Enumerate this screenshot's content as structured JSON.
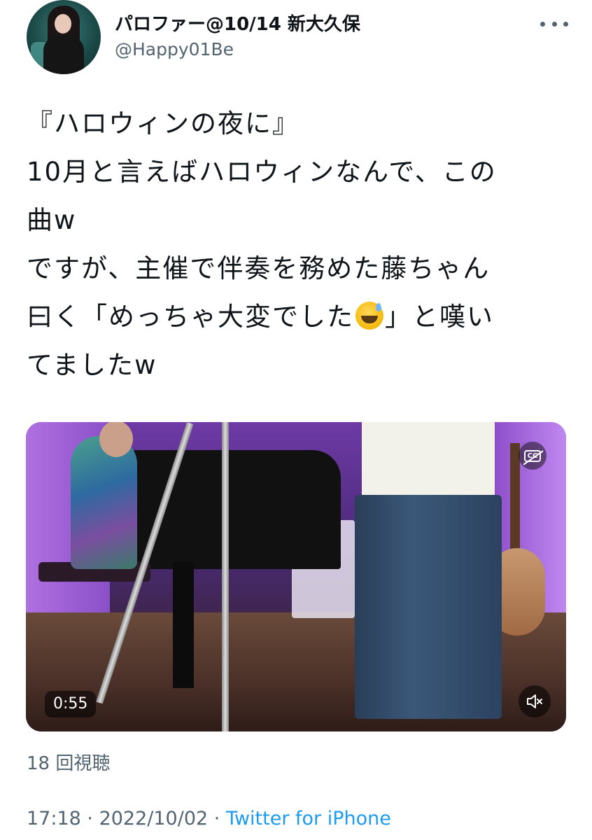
{
  "author": {
    "display_name": "パロファー@10/14 新大久保",
    "handle": "@Happy01Be"
  },
  "icons": {
    "more": "more-horizontal-icon",
    "captions": "captions-off-icon",
    "mute": "volume-muted-icon",
    "emoji": "grinning-face-with-sweat-emoji"
  },
  "tweet": {
    "line1": "『ハロウィンの夜に』",
    "line2": "10月と言えばハロウィンなんで、この",
    "line3": "曲w",
    "line4": "ですが、主催で伴奏を務めた藤ちゃん",
    "line5a": "曰く「めっちゃ大変でした",
    "line5b": "」と嘆い",
    "line6": "てましたw"
  },
  "video": {
    "duration": "0:55"
  },
  "stats": {
    "views": "18 回視聴"
  },
  "meta": {
    "time": "17:18",
    "separator": " · ",
    "date": "2022/10/02",
    "source": "Twitter for iPhone"
  },
  "colors": {
    "text": "#0f1419",
    "secondary": "#536471",
    "link": "#1d9bf0"
  }
}
